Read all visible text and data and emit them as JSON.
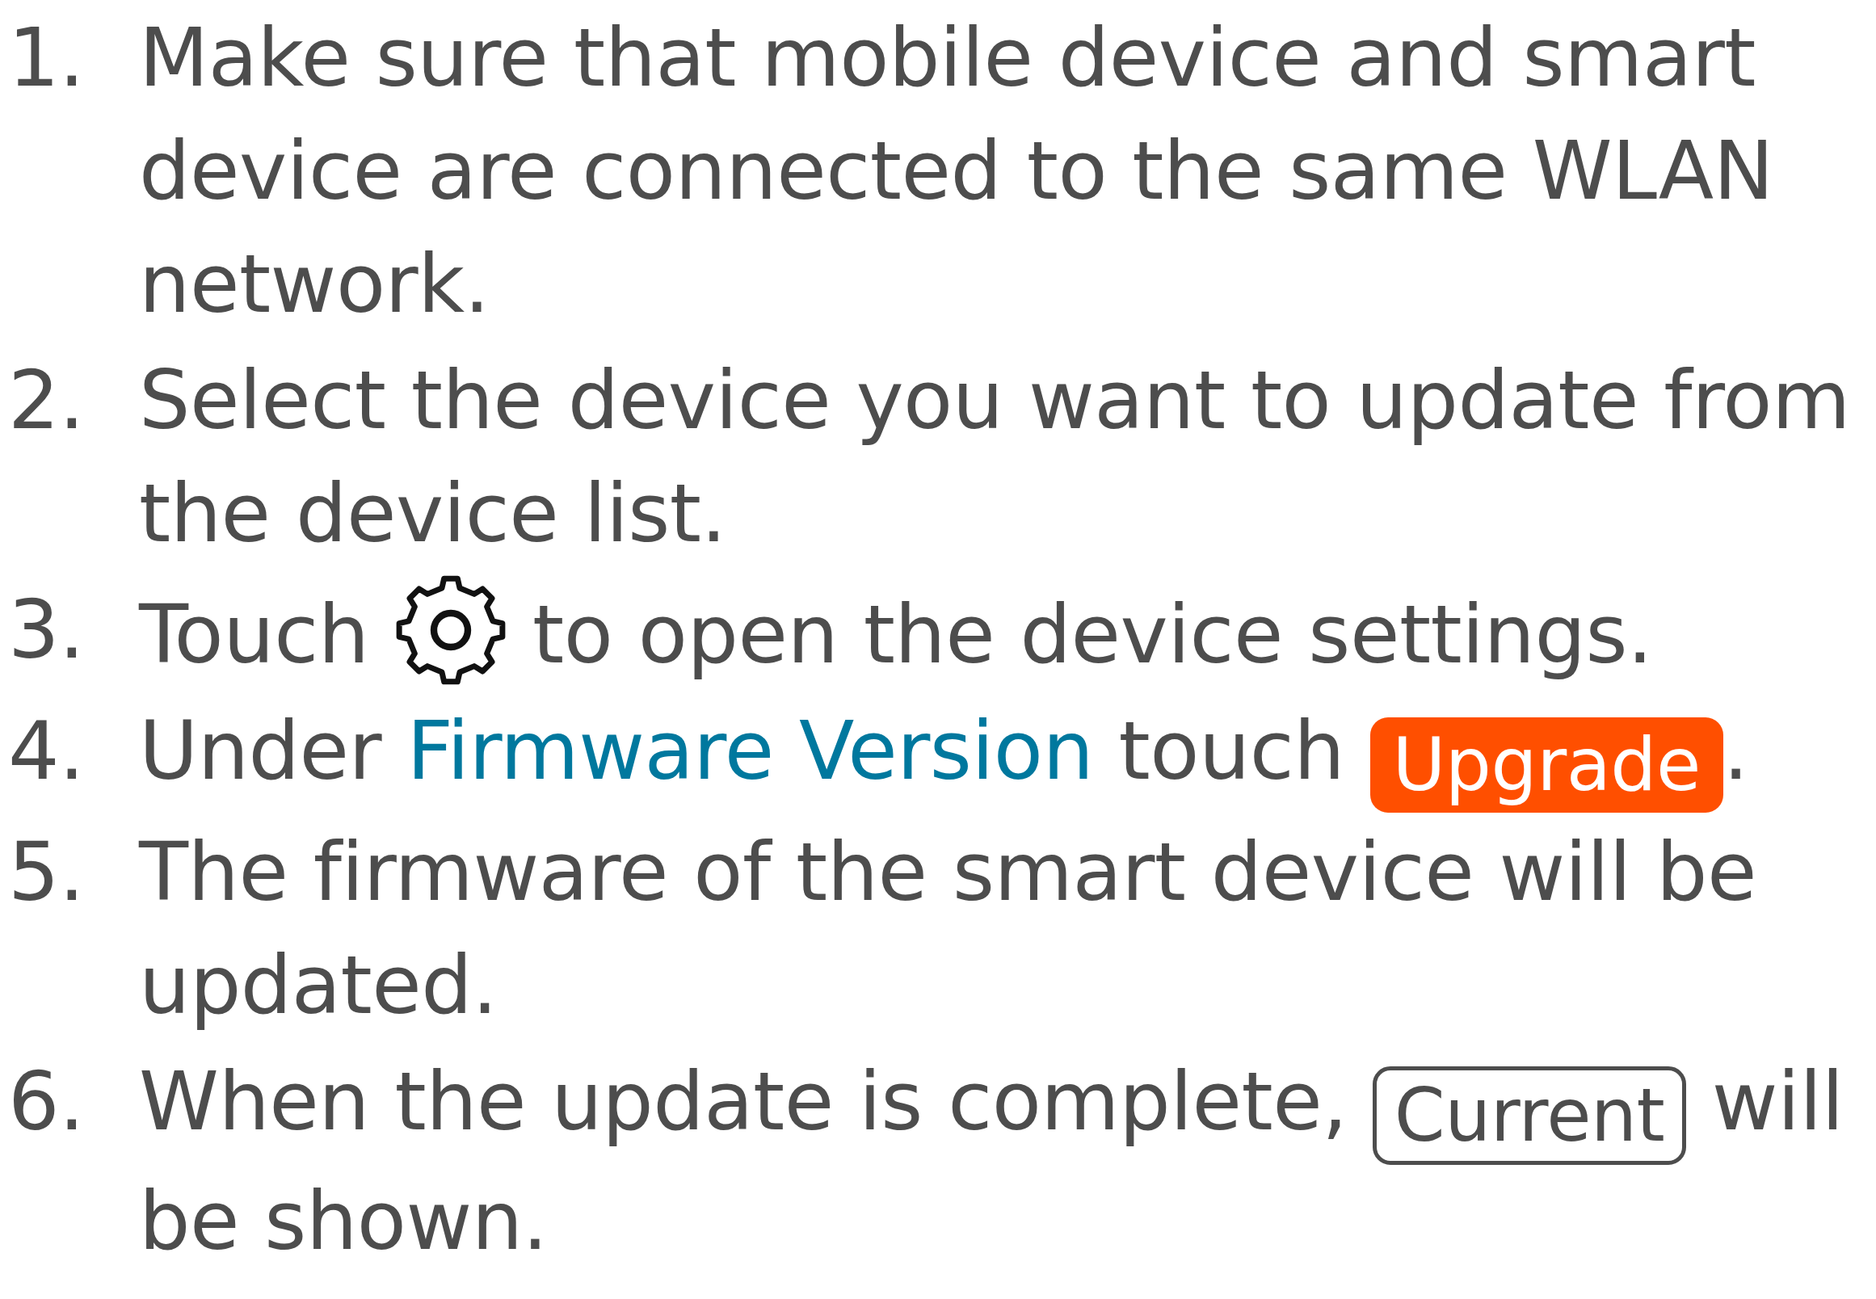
{
  "steps": [
    {
      "number": "1.",
      "parts": [
        {
          "kind": "text",
          "text": "Make sure that mobile device and smart device are connected to the same WLAN network."
        }
      ]
    },
    {
      "number": "2.",
      "parts": [
        {
          "kind": "text",
          "text": "Select the device you want to update from the device list."
        }
      ]
    },
    {
      "number": "3.",
      "parts": [
        {
          "kind": "text",
          "text": "Touch "
        },
        {
          "kind": "gear"
        },
        {
          "kind": "text",
          "text": " to open the device settings."
        }
      ]
    },
    {
      "number": "4.",
      "parts": [
        {
          "kind": "text",
          "text": "Under "
        },
        {
          "kind": "link",
          "text": "Firmware Version"
        },
        {
          "kind": "text",
          "text": " touch "
        },
        {
          "kind": "filled-button",
          "text": "Upgrade"
        },
        {
          "kind": "text",
          "text": "."
        }
      ]
    },
    {
      "number": "5.",
      "parts": [
        {
          "kind": "text",
          "text": "The firmware of the smart device will be updated."
        }
      ]
    },
    {
      "number": "6.",
      "parts": [
        {
          "kind": "text",
          "text": "When the update is complete, "
        },
        {
          "kind": "outline-button",
          "text": "Current"
        },
        {
          "kind": "text",
          "text": " will"
        },
        {
          "kind": "line-break"
        },
        {
          "kind": "text",
          "text": "be shown."
        }
      ]
    }
  ]
}
